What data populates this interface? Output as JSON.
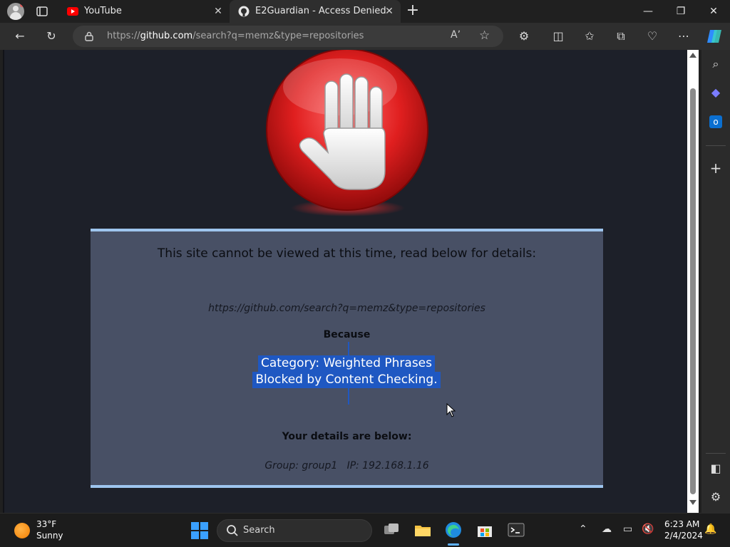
{
  "browser": {
    "tabs": [
      {
        "title": "YouTube",
        "icon": "youtube-icon",
        "active": false
      },
      {
        "title": "E2Guardian - Access Denied",
        "icon": "github-icon",
        "active": true
      }
    ],
    "new_tab_label": "+",
    "address": {
      "prefix": "https://",
      "host": "github.com",
      "path": "/search?q=memz&type=repositories"
    }
  },
  "page": {
    "heading": "This site cannot be viewed at this time, read below for details:",
    "blocked_url": "https://github.com/search?q=memz&type=repositories",
    "because_label": "Because",
    "reason_line1": "Category: Weighted Phrases",
    "reason_line2": "Blocked by Content Checking.",
    "details_label": "Your details are below:",
    "group_line": "Group: group1   IP: 192.168.1.16"
  },
  "taskbar": {
    "weather_temp": "33°F",
    "weather_condition": "Sunny",
    "search_placeholder": "Search",
    "time": "6:23 AM",
    "date": "2/4/2024"
  },
  "colors": {
    "panel_background": "#485065",
    "panel_border": "#9ec5ee",
    "selection": "#1f58c2",
    "page_background": "#1d2029",
    "stop_red": "#e01f1f"
  }
}
